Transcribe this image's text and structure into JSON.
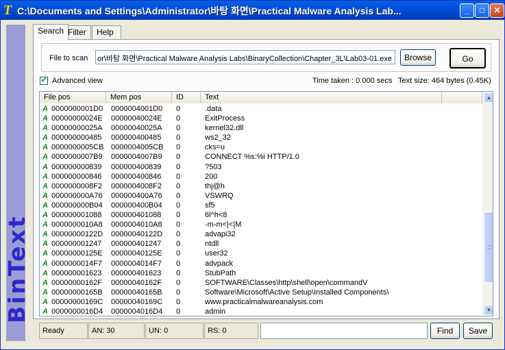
{
  "window": {
    "title": "C:\\Documents and Settings\\Administrator\\바탕 화면\\Practical Malware Analysis Lab...",
    "app_icon_glyph": "T",
    "minimize_glyph": "_",
    "maximize_glyph": "□",
    "close_glyph": "✕"
  },
  "brand": {
    "text": "BinText"
  },
  "tabs": [
    {
      "label": "Search"
    },
    {
      "label": "Filter"
    },
    {
      "label": "Help"
    }
  ],
  "scan": {
    "label": "File to scan",
    "path": "or\\바탕 화면\\Practical Malware Analysis Labs\\BinaryCollection\\Chapter_3L\\Lab03-01.exe",
    "browse_label": "Browse",
    "go_label": "Go"
  },
  "options": {
    "advanced_view_label": "Advanced view",
    "advanced_view_checked": true,
    "check_glyph": "✔",
    "time_taken": "Time taken : 0.000 secs",
    "text_size": "Text size: 464 bytes (0.45K)"
  },
  "list": {
    "columns": [
      "File pos",
      "Mem pos",
      "ID",
      "Text"
    ],
    "type_glyph": "A",
    "rows": [
      {
        "file": "0000000001D0",
        "mem": "0000004001D0",
        "id": "0",
        "text": ".data"
      },
      {
        "file": "00000000024E",
        "mem": "00000040024E",
        "id": "0",
        "text": "ExitProcess"
      },
      {
        "file": "00000000025A",
        "mem": "00000040025A",
        "id": "0",
        "text": "kernel32.dll"
      },
      {
        "file": "000000000485",
        "mem": "000000400485",
        "id": "0",
        "text": "ws2_32"
      },
      {
        "file": "0000000005CB",
        "mem": "0000004005CB",
        "id": "0",
        "text": "cks=u"
      },
      {
        "file": "0000000007B9",
        "mem": "0000004007B9",
        "id": "0",
        "text": "CONNECT %s:%i HTTP/1.0"
      },
      {
        "file": "000000000839",
        "mem": "000000400839",
        "id": "0",
        "text": "?503"
      },
      {
        "file": "000000000846",
        "mem": "000000400846",
        "id": "0",
        "text": "200"
      },
      {
        "file": "0000000008F2",
        "mem": "0000004008F2",
        "id": "0",
        "text": "thj@h"
      },
      {
        "file": "000000000A76",
        "mem": "000000400A76",
        "id": "0",
        "text": "VSWRQ"
      },
      {
        "file": "000000000B04",
        "mem": "000000400B04",
        "id": "0",
        "text": "sf5"
      },
      {
        "file": "000000001088",
        "mem": "000000401088",
        "id": "0",
        "text": "6l^h<8"
      },
      {
        "file": "0000000010A8",
        "mem": "0000004010A8",
        "id": "0",
        "text": "-m-m<|<|M"
      },
      {
        "file": "00000000122D",
        "mem": "00000040122D",
        "id": "0",
        "text": "advapi32"
      },
      {
        "file": "000000001247",
        "mem": "000000401247",
        "id": "0",
        "text": "ntdll"
      },
      {
        "file": "00000000125E",
        "mem": "00000040125E",
        "id": "0",
        "text": "user32"
      },
      {
        "file": "0000000014F7",
        "mem": "0000004014F7",
        "id": "0",
        "text": "advpack"
      },
      {
        "file": "000000001623",
        "mem": "000000401623",
        "id": "0",
        "text": "StubPath"
      },
      {
        "file": "00000000162F",
        "mem": "00000040162F",
        "id": "0",
        "text": "SOFTWARE\\Classes\\http\\shell\\open\\commandV"
      },
      {
        "file": "00000000165B",
        "mem": "00000040165B",
        "id": "0",
        "text": "Software\\Microsoft\\Active Setup\\Installed Components\\"
      },
      {
        "file": "00000000169C",
        "mem": "00000040169C",
        "id": "0",
        "text": " www.practicalmalwareanalysis.com"
      },
      {
        "file": "0000000016D4",
        "mem": "0000004016D4",
        "id": "0",
        "text": "admin"
      }
    ]
  },
  "scrollbar": {
    "up_glyph": "▲",
    "down_glyph": "▼"
  },
  "status": {
    "ready": "Ready",
    "an": "AN: 30",
    "un": "UN: 0",
    "rs": "RS: 0",
    "find_value": "",
    "find_label": "Find",
    "save_label": "Save"
  }
}
